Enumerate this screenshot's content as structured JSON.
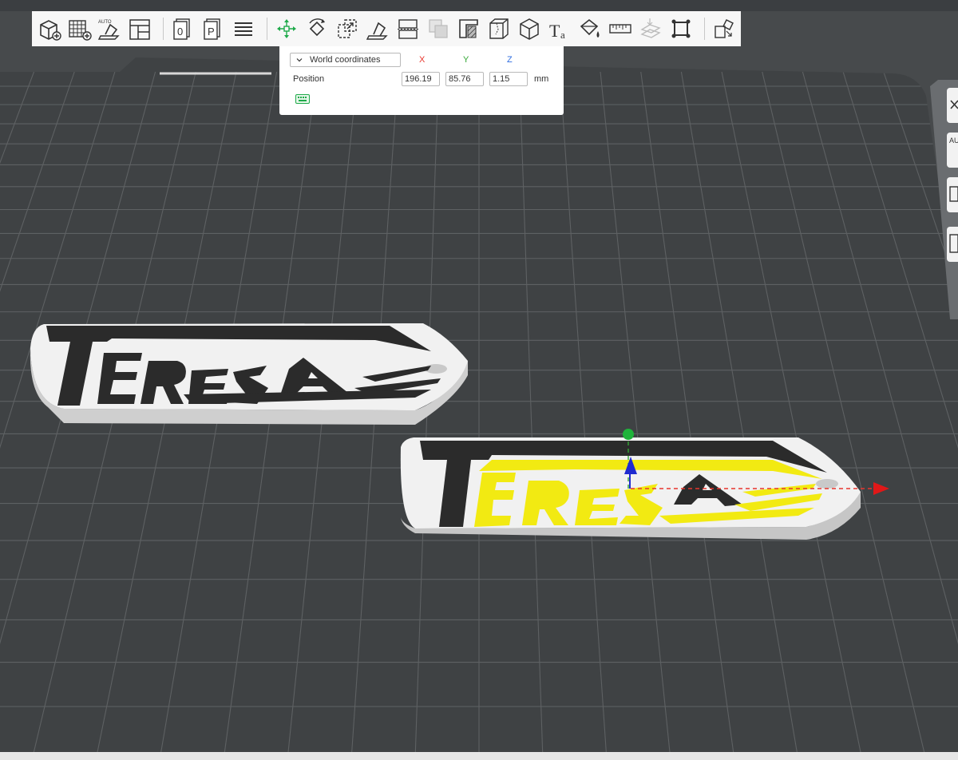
{
  "colors": {
    "workspace": "#474a4c",
    "bed": "#3f4244",
    "grid": "#5e6163",
    "model_base": "#eeeeee",
    "text_dark": "#2b2b2b",
    "text_yellow": "#f2ea12",
    "axis_x": "#e8362e",
    "axis_y": "#34a836",
    "axis_z": "#1f2bd0"
  },
  "toolbar": {
    "items": [
      {
        "name": "add-cube-icon",
        "tip": "add"
      },
      {
        "name": "grid-add-icon",
        "tip": "add plate"
      },
      {
        "name": "auto-orient-icon",
        "tip": "auto orient",
        "badge": "AUTO"
      },
      {
        "name": "arrange-icon",
        "tip": "arrange"
      },
      {
        "name": "sep"
      },
      {
        "name": "plate-0-icon",
        "glyph": "0"
      },
      {
        "name": "plate-p-icon",
        "glyph": "P"
      },
      {
        "name": "layers-icon"
      },
      {
        "name": "sep"
      },
      {
        "name": "move-icon"
      },
      {
        "name": "rotate-icon"
      },
      {
        "name": "scale-icon"
      },
      {
        "name": "lay-on-face-icon"
      },
      {
        "name": "cut-icon"
      },
      {
        "name": "boolean-icon"
      },
      {
        "name": "support-paint-icon"
      },
      {
        "name": "seam-paint-icon"
      },
      {
        "name": "measure-box-icon"
      },
      {
        "name": "text-icon",
        "glyph": "T",
        "sub": "a"
      },
      {
        "name": "color-paint-icon"
      },
      {
        "name": "ruler-icon"
      },
      {
        "name": "assembly-icon"
      },
      {
        "name": "fit-view-icon"
      },
      {
        "name": "sep"
      },
      {
        "name": "explode-icon"
      }
    ]
  },
  "move_panel": {
    "coord_system": "World coordinates",
    "axis_x": "X",
    "axis_y": "Y",
    "axis_z": "Z",
    "position_label": "Position",
    "x": "196.19",
    "y": "85.76",
    "z": "1.15",
    "unit": "mm"
  },
  "models": [
    {
      "name": "keychain-teresa-1",
      "text": "TERESA",
      "selected": false
    },
    {
      "name": "keychain-teresa-2",
      "text": "TERESA",
      "selected": true
    }
  ],
  "side_buttons": [
    {
      "name": "side-close-icon",
      "label": ""
    },
    {
      "name": "side-auto-icon",
      "label": "AU"
    },
    {
      "name": "side-plate-icon",
      "label": ""
    },
    {
      "name": "side-lock-icon",
      "label": ""
    }
  ]
}
